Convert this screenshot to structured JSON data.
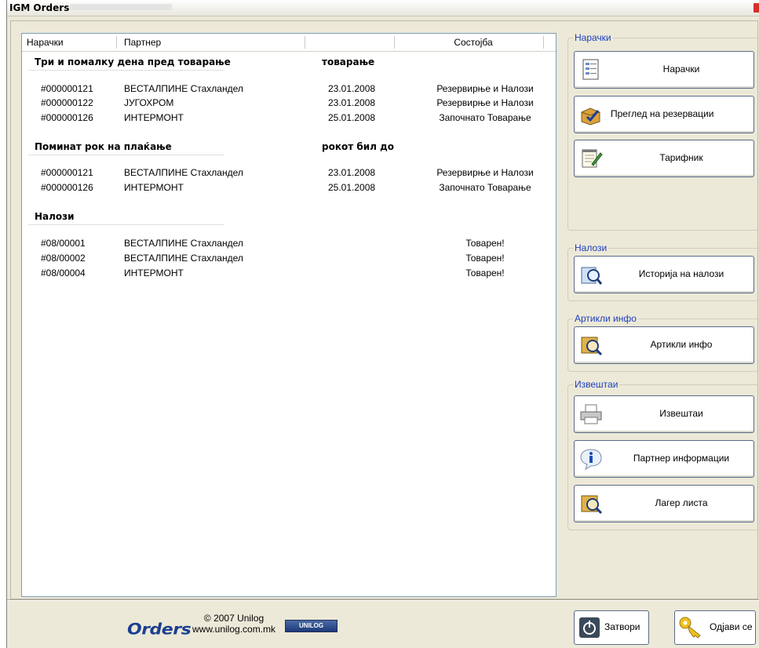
{
  "window": {
    "title": "IGM Orders"
  },
  "list": {
    "columns": [
      "Нарачки",
      "Партнер",
      "",
      "Состојба"
    ],
    "sections": [
      {
        "title": "Три и помалку дена пред товарање",
        "date_header": "товарање",
        "rows": [
          {
            "id": "#000000121",
            "partner": "ВЕСТАЛПИНЕ Стахландел",
            "date": "23.01.2008",
            "status": "Резервирње и Налози"
          },
          {
            "id": "#000000122",
            "partner": "ЈУГОХРОМ",
            "date": "23.01.2008",
            "status": "Резервирње и Налози"
          },
          {
            "id": "#000000126",
            "partner": "ИНТЕРМОНТ",
            "date": "25.01.2008",
            "status": "Започнато Товарање"
          }
        ]
      },
      {
        "title": "Поминат рок на плаќање",
        "date_header": "рокот бил до",
        "rows": [
          {
            "id": "#000000121",
            "partner": "ВЕСТАЛПИНЕ Стахландел",
            "date": "23.01.2008",
            "status": "Резервирње и Налози"
          },
          {
            "id": "#000000126",
            "partner": "ИНТЕРМОНТ",
            "date": "25.01.2008",
            "status": "Започнато Товарање"
          }
        ]
      },
      {
        "title": "Налози",
        "date_header": "",
        "rows": [
          {
            "id": "#08/00001",
            "partner": "ВЕСТАЛПИНЕ Стахландел",
            "date": "",
            "status": "Товарен!"
          },
          {
            "id": "#08/00002",
            "partner": "ВЕСТАЛПИНЕ Стахландел",
            "date": "",
            "status": "Товарен!"
          },
          {
            "id": "#08/00004",
            "partner": "ИНТЕРМОНТ",
            "date": "",
            "status": "Товарен!"
          }
        ]
      }
    ]
  },
  "groups": {
    "orders": {
      "label": "Нарачки",
      "buttons": [
        "Нарачки",
        "Преглед на резервации",
        "Тарифник"
      ]
    },
    "nalozi": {
      "label": "Налози",
      "buttons": [
        "Историја на налози"
      ]
    },
    "articles": {
      "label": "Артикли инфо",
      "buttons": [
        "Артикли инфо"
      ]
    },
    "reports": {
      "label": "Извештаи",
      "buttons": [
        "Извештаи",
        "Партнер информации",
        "Лагер листа"
      ]
    }
  },
  "footer": {
    "logo": "Orders",
    "copyright": "© 2007 Unilog",
    "website": "www.unilog.com.mk",
    "unilog_logo": "UNILOG",
    "close_label": "Затвори",
    "logout_label": "Одјави се"
  }
}
